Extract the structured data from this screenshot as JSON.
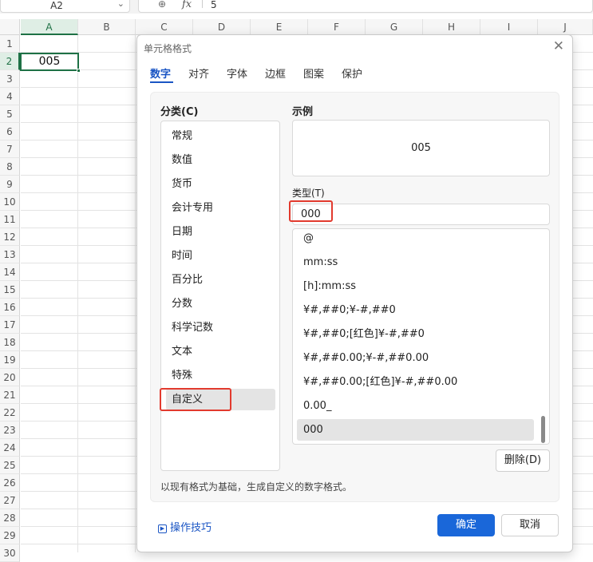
{
  "formula_bar": {
    "name_box": "A2",
    "value": "5",
    "fx_label": "fx"
  },
  "sheet": {
    "columns": [
      "A",
      "B",
      "C",
      "D",
      "E",
      "F",
      "G",
      "H",
      "I",
      "J"
    ],
    "rows": [
      "1",
      "2",
      "3",
      "4",
      "5",
      "6",
      "7",
      "8",
      "9",
      "10",
      "11",
      "12",
      "13",
      "14",
      "15",
      "16",
      "17",
      "18",
      "19",
      "20",
      "21",
      "22",
      "23",
      "24",
      "25",
      "26",
      "27",
      "28",
      "29",
      "30"
    ],
    "active_cell_value": "005"
  },
  "dialog": {
    "title": "单元格格式",
    "tabs": [
      "数字",
      "对齐",
      "字体",
      "边框",
      "图案",
      "保护"
    ],
    "category_label": "分类(C)",
    "categories": [
      "常规",
      "数值",
      "货币",
      "会计专用",
      "日期",
      "时间",
      "百分比",
      "分数",
      "科学记数",
      "文本",
      "特殊",
      "自定义"
    ],
    "sample_label": "示例",
    "sample_value": "005",
    "type_label": "类型(T)",
    "type_value": "000",
    "formats": [
      "@",
      "mm:ss",
      "[h]:mm:ss",
      "¥#,##0;¥-#,##0",
      "¥#,##0;[红色]¥-#,##0",
      "¥#,##0.00;¥-#,##0.00",
      "¥#,##0.00;[红色]¥-#,##0.00",
      "0.00_",
      "000"
    ],
    "delete_button": "删除(D)",
    "description": "以现有格式为基础，生成自定义的数字格式。",
    "tips_link": "操作技巧",
    "ok_button": "确定",
    "cancel_button": "取消"
  },
  "colors": {
    "accent": "#1a67d9",
    "cell_selection": "#1e7145",
    "highlight_box": "#e23a2e"
  }
}
